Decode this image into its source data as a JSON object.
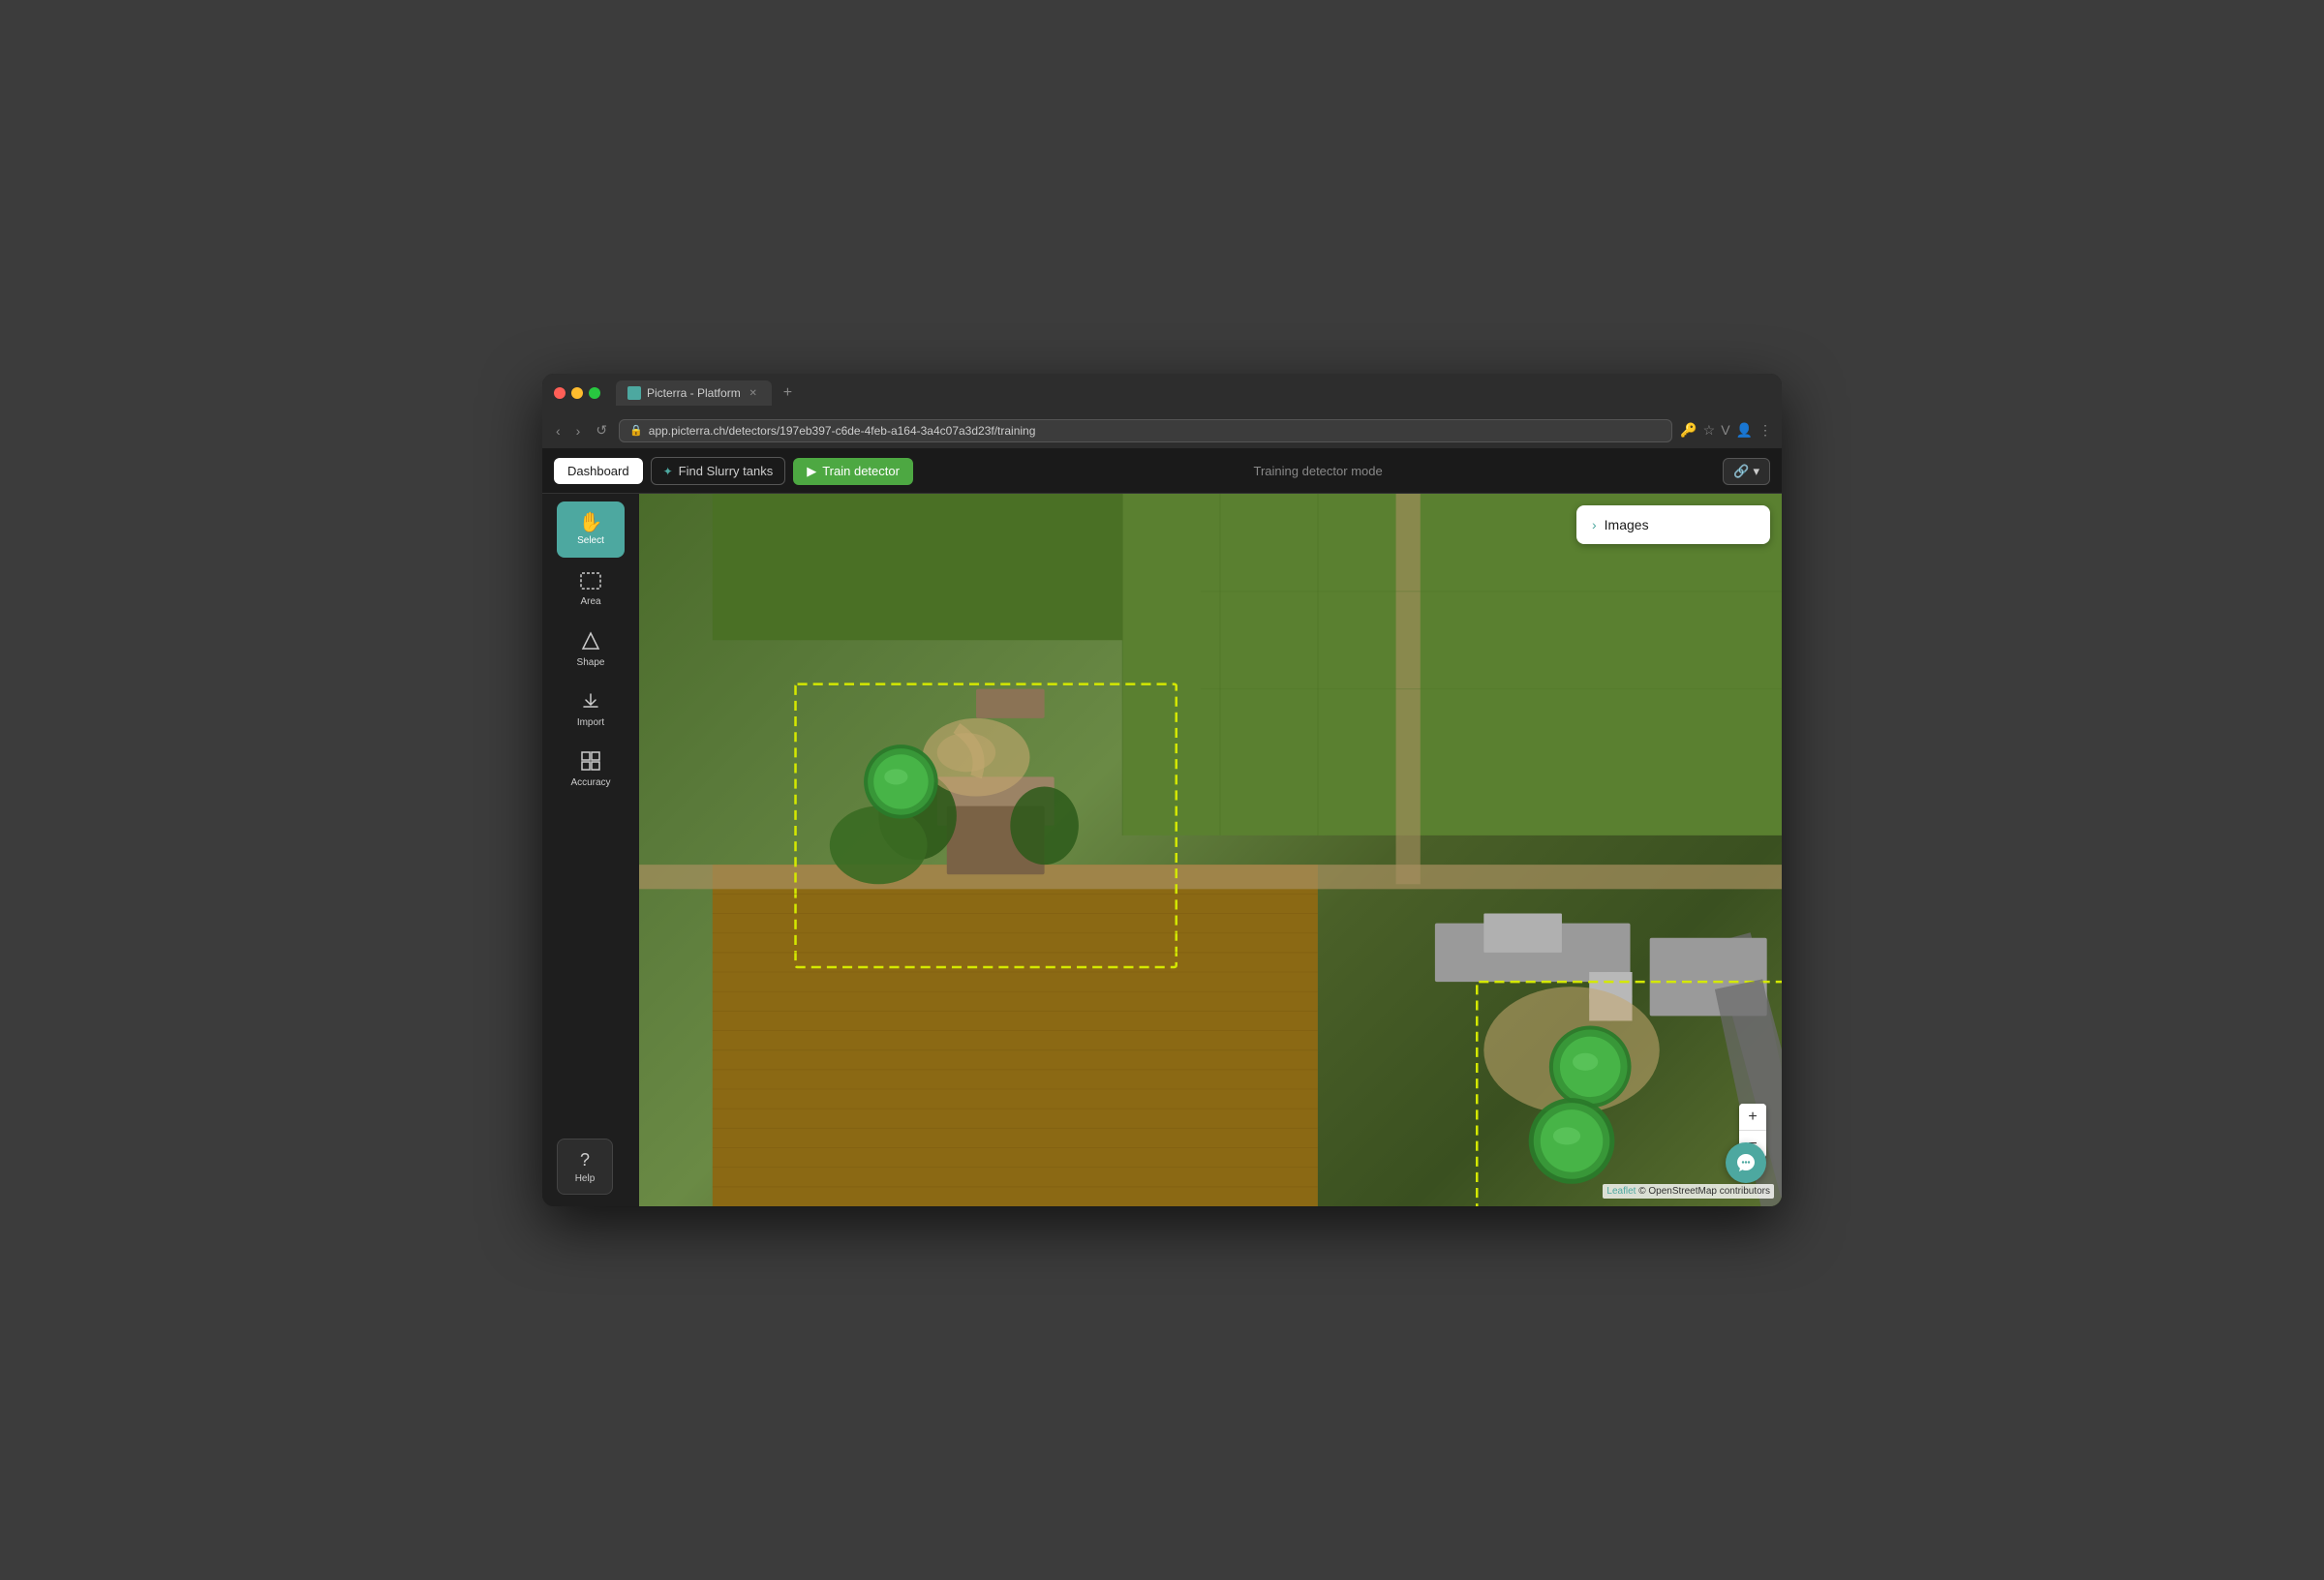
{
  "window": {
    "title": "Picterra - Platform",
    "url": "app.picterra.ch/detectors/197eb397-c6de-4feb-a164-3a4c07a3d23f/training"
  },
  "toolbar": {
    "dashboard_label": "Dashboard",
    "find_slurry_label": "Find Slurry tanks",
    "train_label": "Train detector",
    "mode_label": "Training detector mode",
    "share_label": "🔗"
  },
  "tools": [
    {
      "id": "select",
      "label": "Select",
      "icon": "✋",
      "active": true
    },
    {
      "id": "area",
      "label": "Area",
      "icon": "⋯",
      "active": false
    },
    {
      "id": "shape",
      "label": "Shape",
      "icon": "◇",
      "active": false
    },
    {
      "id": "import",
      "label": "Import",
      "icon": "⬆",
      "active": false
    },
    {
      "id": "accuracy",
      "label": "Accuracy",
      "icon": "⊞",
      "active": false
    }
  ],
  "help": {
    "label": "Help",
    "icon": "?"
  },
  "images_panel": {
    "label": "Images",
    "chevron": "›"
  },
  "zoom": {
    "plus": "+",
    "minus": "−"
  },
  "attribution": {
    "leaflet": "Leaflet",
    "osm": "© OpenStreetMap contributors"
  }
}
